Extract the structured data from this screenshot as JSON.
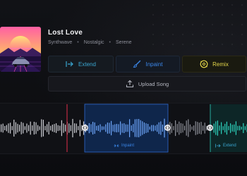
{
  "song": {
    "title": "Lost Love",
    "tags": [
      "Synthwave",
      "Nostalgic",
      "Serene"
    ]
  },
  "actions": {
    "extend_label": "Extend",
    "inpaint_label": "Inpaint",
    "remix_label": "Remix",
    "upload_label": "Upload Song"
  },
  "waveform": {
    "inpaint_label": "Inpaint",
    "extend_label": "Extend"
  },
  "icons": {
    "extend": "extend-arrow-icon",
    "inpaint": "brush-icon",
    "remix": "remix-disc-icon",
    "upload": "upload-icon",
    "inpaint_small": "double-arrow-icon",
    "extend_small": "arrow-bar-icon"
  },
  "colors": {
    "extend": "#3aa7d2",
    "inpaint": "#3a86e8",
    "remix": "#e5d84a",
    "playhead": "#e0304a",
    "extend_region": "#2dd4bf"
  }
}
